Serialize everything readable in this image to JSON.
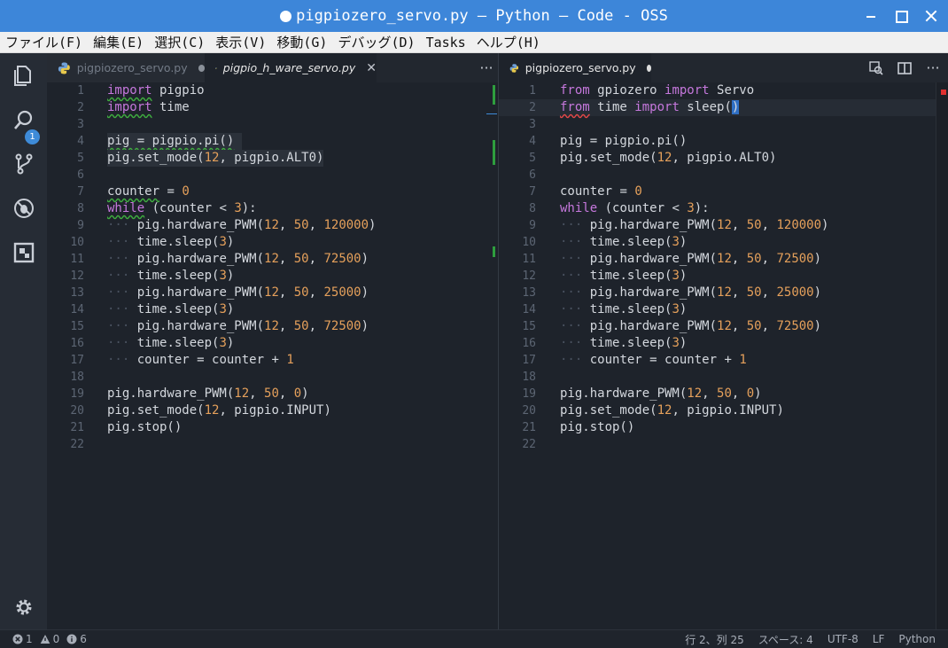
{
  "window": {
    "title": "pigpiozero_servo.py — Python — Code - OSS"
  },
  "menu": [
    "ファイル(F)",
    "編集(E)",
    "選択(C)",
    "表示(V)",
    "移動(G)",
    "デバッグ(D)",
    "Tasks",
    "ヘルプ(H)"
  ],
  "activity": {
    "explorer_badge": "1"
  },
  "left_group": {
    "tabs": [
      {
        "label": "pigpiozero_servo.py",
        "modified": true
      },
      {
        "label": "pigpio_h_ware_servo.py",
        "active": true
      }
    ],
    "lines": [
      {
        "n": "1"
      },
      {
        "n": "2"
      },
      {
        "n": "3"
      },
      {
        "n": "4"
      },
      {
        "n": "5"
      },
      {
        "n": "6"
      },
      {
        "n": "7"
      },
      {
        "n": "8"
      },
      {
        "n": "9"
      },
      {
        "n": "10"
      },
      {
        "n": "11"
      },
      {
        "n": "12"
      },
      {
        "n": "13"
      },
      {
        "n": "14"
      },
      {
        "n": "15"
      },
      {
        "n": "16"
      },
      {
        "n": "17"
      },
      {
        "n": "18"
      },
      {
        "n": "19"
      },
      {
        "n": "20"
      },
      {
        "n": "21"
      },
      {
        "n": "22"
      }
    ],
    "code": {
      "l1_kw": "import",
      "l1_rest": " pigpio",
      "l2_kw": "import",
      "l2_rest": " time",
      "l4": "pig = pigpio.pi()",
      "l5_a": "pig.set_mode(",
      "l5_num": "12",
      "l5_b": ", pigpio.ALT0)",
      "l7_a": "counter",
      "l7_b": " = ",
      "l7_num": "0",
      "l8_kw": "while",
      "l8_a": " (counter < ",
      "l8_num": "3",
      "l8_b": "):",
      "pwm_a": "pig.hardware_PWM(",
      "n12": "12",
      "sep": ", ",
      "n50": "50",
      "v120000": "120000",
      "v72500": "72500",
      "v25000": "25000",
      "close": ")",
      "sleep_a": "time.sleep(",
      "n3": "3",
      "l17_a": "counter = counter + ",
      "l17_num": "1",
      "l19_a": "pig.hardware_PWM(",
      "l19_n1": "12",
      "l19_n2": "50",
      "l19_n3": "0",
      "l20_a": "pig.set_mode(",
      "l20_num": "12",
      "l20_b": ", pigpio.INPUT)",
      "l21": "pig.stop()",
      "indent": "···"
    }
  },
  "right_group": {
    "tabs": [
      {
        "label": "pigpiozero_servo.py",
        "active": true,
        "modified": true
      }
    ],
    "code": {
      "l1_kw1": "from",
      "l1_a": " gpiozero ",
      "l1_kw2": "import",
      "l1_b": " Servo",
      "l2_kw1": "from",
      "l2_a": " time ",
      "l2_kw2": "import",
      "l2_b": " sleep(",
      "l2_c": ")"
    }
  },
  "status": {
    "errors": "1",
    "warnings": "0",
    "info": "6",
    "position": "行 2、列 25",
    "spaces": "スペース: 4",
    "encoding": "UTF-8",
    "eol": "LF",
    "language": "Python"
  }
}
